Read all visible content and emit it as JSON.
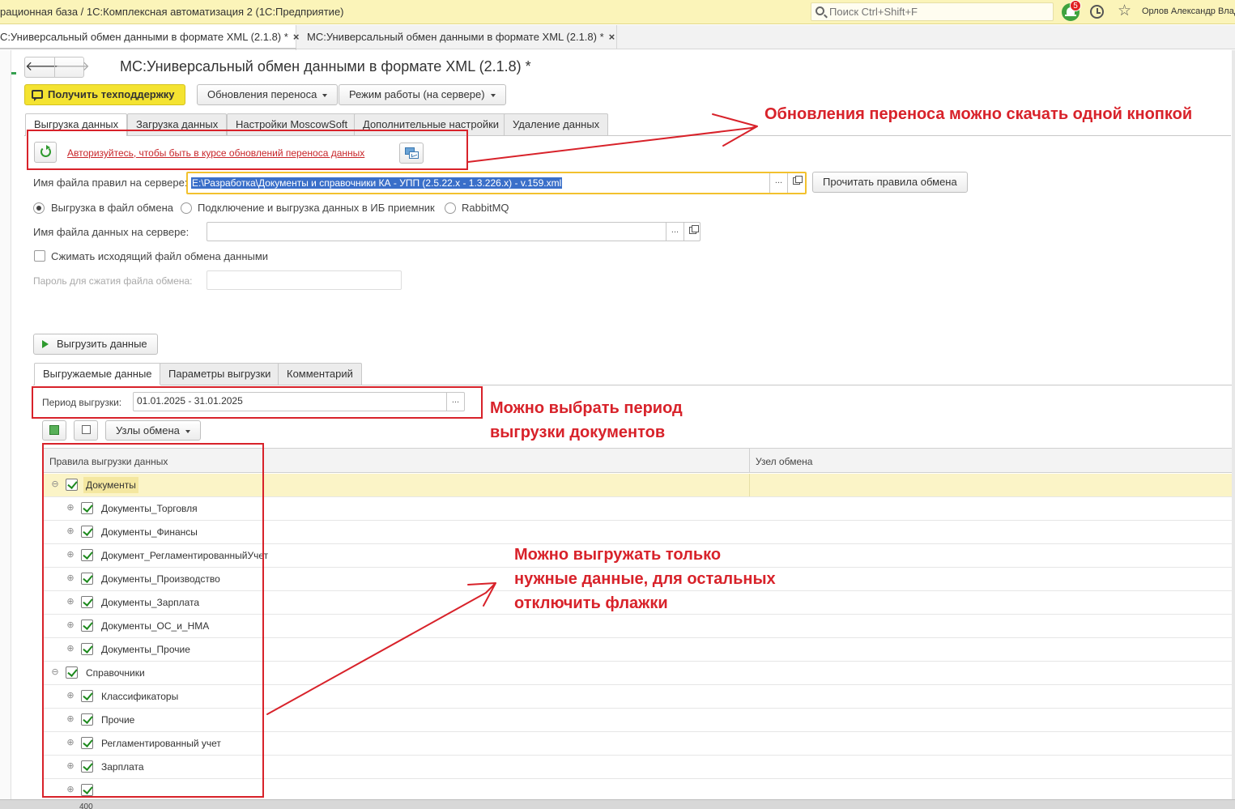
{
  "titlebar": {
    "title": "рационная база / 1С:Комплексная автоматизация 2  (1С:Предприятие)",
    "search_placeholder": "Поиск Ctrl+Shift+F",
    "notifications_count": "5",
    "user": "Орлов Александр Влад"
  },
  "window_tabs": [
    {
      "label": "С:Универсальный обмен данными в формате XML (2.1.8) *",
      "close": "×"
    },
    {
      "label": "МС:Универсальный обмен данными в формате XML (2.1.8) *",
      "close": "×"
    }
  ],
  "form": {
    "nav_back": "🡐",
    "nav_forward": "🡒",
    "title": "МС:Универсальный обмен данными в формате XML (2.1.8) *",
    "support_button": "Получить техподдержку",
    "updates_button": "Обновления переноса",
    "mode_button": "Режим работы (на сервере)"
  },
  "main_tabs": [
    "Выгрузка данных",
    "Загрузка данных",
    "Настройки MoscowSoft",
    "Дополнительные настройки",
    "Удаление данных"
  ],
  "auth_link": "Авторизуйтесь, чтобы быть в курсе обновлений переноса данных",
  "rules_file": {
    "label": "Имя файла правил на сервере:",
    "value": "E:\\Разработка\\Документы и справочники КА - УПП (2.5.22.x - 1.3.226.x) - v.159.xml",
    "choose": "...",
    "read_button": "Прочитать правила обмена"
  },
  "radio_options": [
    {
      "label": "Выгрузка в файл обмена",
      "selected": true
    },
    {
      "label": "Подключение и выгрузка данных в ИБ приемник",
      "selected": false
    },
    {
      "label": "RabbitMQ",
      "selected": false
    }
  ],
  "data_file": {
    "label": "Имя файла данных на сервере:",
    "value": "",
    "choose": "..."
  },
  "compress": {
    "label": "Сжимать исходящий файл обмена данными",
    "checked": false
  },
  "password": {
    "label": "Пароль для сжатия файла обмена:",
    "value": ""
  },
  "export_button": "Выгрузить данные",
  "sub_tabs": [
    "Выгружаемые данные",
    "Параметры выгрузки",
    "Комментарий"
  ],
  "period": {
    "label": "Период выгрузки:",
    "value": "01.01.2025 - 31.01.2025",
    "choose": "..."
  },
  "exchange_nodes_button": "Узлы обмена",
  "grid": {
    "col_rules": "Правила выгрузки данных",
    "col_node": "Узел обмена",
    "rows": [
      {
        "level": 0,
        "expander": "⊖",
        "label": "Документы",
        "checked": true
      },
      {
        "level": 1,
        "expander": "⊕",
        "label": "Документы_Торговля",
        "checked": true
      },
      {
        "level": 1,
        "expander": "⊕",
        "label": "Документы_Финансы",
        "checked": true
      },
      {
        "level": 1,
        "expander": "⊕",
        "label": "Документ_РегламентированныйУчет",
        "checked": true
      },
      {
        "level": 1,
        "expander": "⊕",
        "label": "Документы_Производство",
        "checked": true
      },
      {
        "level": 1,
        "expander": "⊕",
        "label": "Документы_Зарплата",
        "checked": true
      },
      {
        "level": 1,
        "expander": "⊕",
        "label": "Документы_ОС_и_НМА",
        "checked": true
      },
      {
        "level": 1,
        "expander": "⊕",
        "label": "Документы_Прочие",
        "checked": true
      },
      {
        "level": 0,
        "expander": "⊖",
        "label": "Справочники",
        "checked": true
      },
      {
        "level": 1,
        "expander": "⊕",
        "label": "Классификаторы",
        "checked": true
      },
      {
        "level": 1,
        "expander": "⊕",
        "label": "Прочие",
        "checked": true
      },
      {
        "level": 1,
        "expander": "⊕",
        "label": "Регламентированный учет",
        "checked": true
      },
      {
        "level": 1,
        "expander": "⊕",
        "label": "Зарплата",
        "checked": true
      },
      {
        "level": 1,
        "expander": "⊕",
        "label": "",
        "checked": true
      }
    ]
  },
  "statusbar_text": "400",
  "annotations": {
    "note1": "Обновления переноса можно скачать одной кнопкой",
    "note2_line1": "Можно выбрать период",
    "note2_line2": "выгрузки документов",
    "note3_line1": "Можно выгружать только",
    "note3_line2": "нужные данные, для остальных",
    "note3_line3": "отключить флажки"
  },
  "colors": {
    "annotation_red": "#d8222a",
    "accent_yellow": "#f4e331",
    "titlebar": "#fbf4b9"
  }
}
